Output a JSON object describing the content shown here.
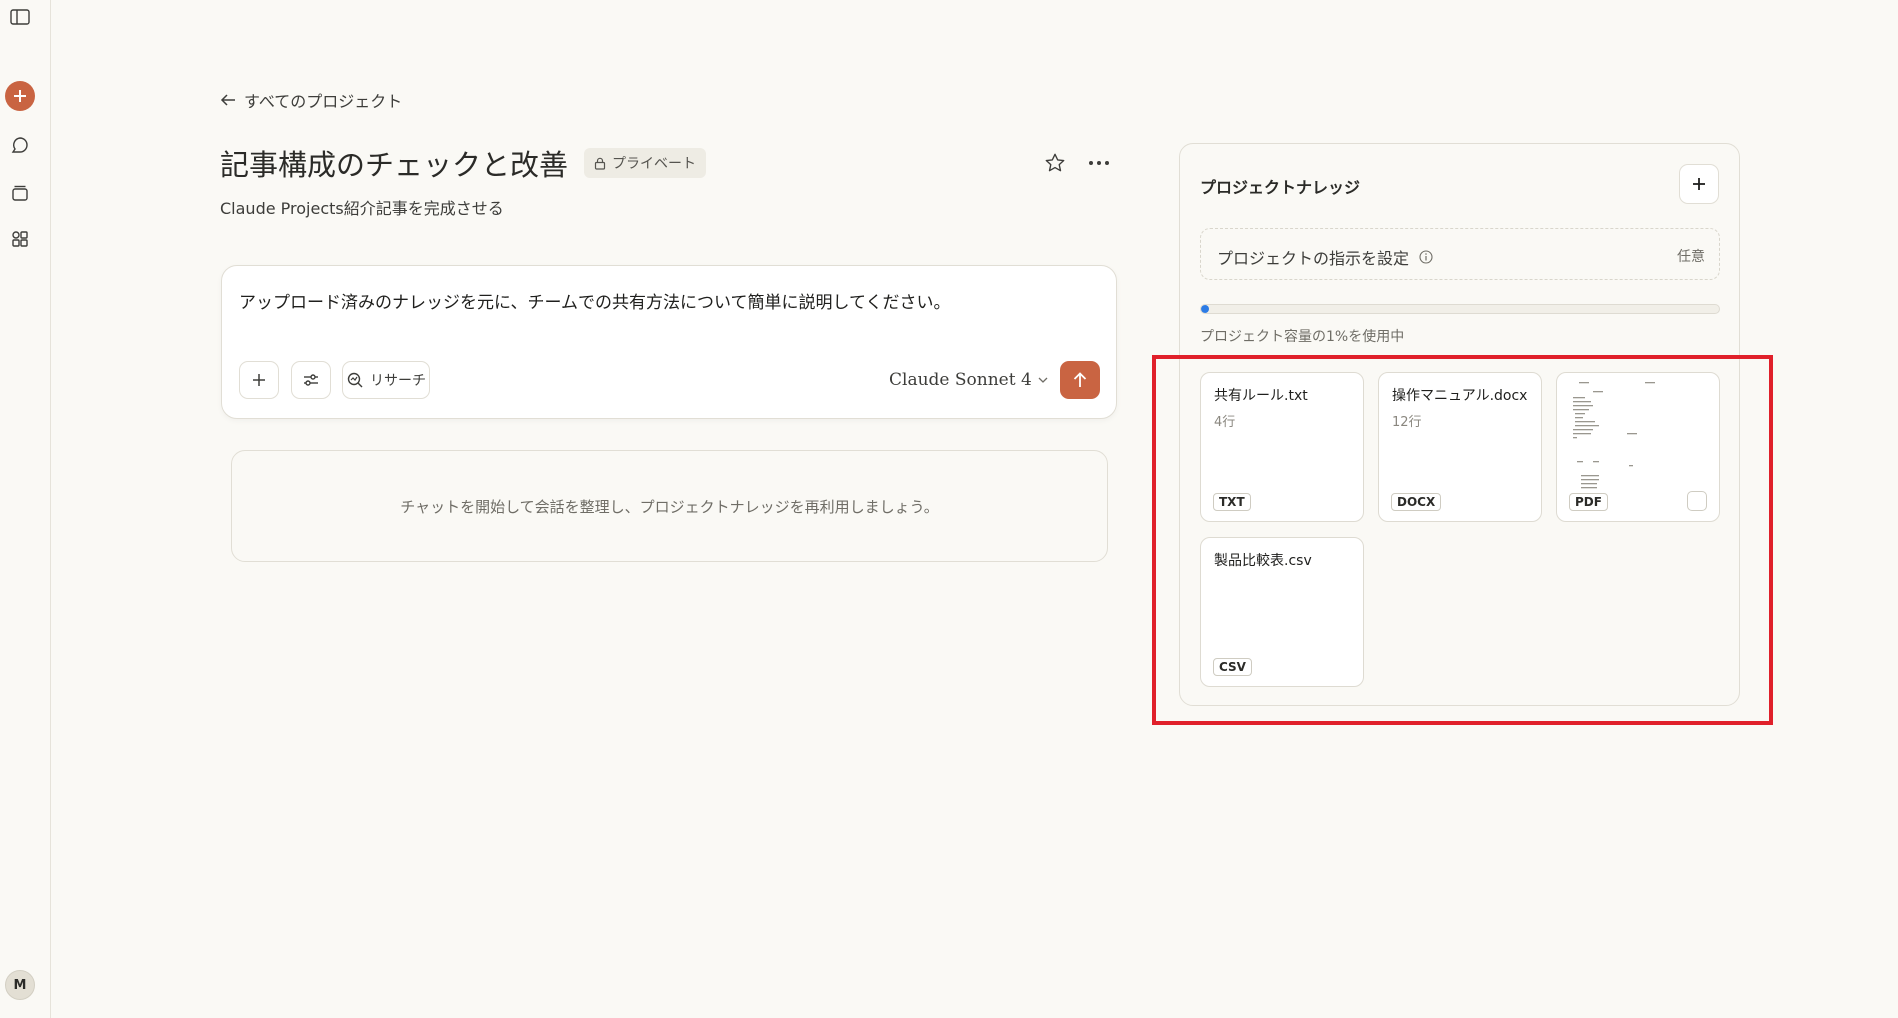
{
  "nav": {
    "back_label": "すべてのプロジェクト"
  },
  "project": {
    "title": "記事構成のチェックと改善",
    "visibility": "プライベート",
    "description": "Claude Projects紹介記事を完成させる"
  },
  "composer": {
    "text": "アップロード済みのナレッジを元に、チームでの共有方法について簡単に説明してください。",
    "research_label": "リサーチ",
    "model": "Claude Sonnet 4"
  },
  "chat": {
    "empty_message": "チャットを開始して会話を整理し、プロジェクトナレッジを再利用しましょう。"
  },
  "knowledge": {
    "title": "プロジェクトナレッジ",
    "instructions_label": "プロジェクトの指示を設定",
    "instructions_optional": "任意",
    "capacity_used_fraction": 0.01,
    "capacity_text": "プロジェクト容量の1%を使用中",
    "files": [
      {
        "name": "共有ルール.txt",
        "lines": "4行",
        "type": "TXT"
      },
      {
        "name": "操作マニュアル.docx",
        "lines": "12行",
        "type": "DOCX"
      },
      {
        "name": "",
        "lines": "",
        "type": "PDF"
      },
      {
        "name": "製品比較表.csv",
        "lines": "",
        "type": "CSV"
      }
    ]
  },
  "user": {
    "initial": "M"
  },
  "colors": {
    "accent": "#c96442",
    "highlight": "#e0202a",
    "capacity": "#2c7be5"
  }
}
